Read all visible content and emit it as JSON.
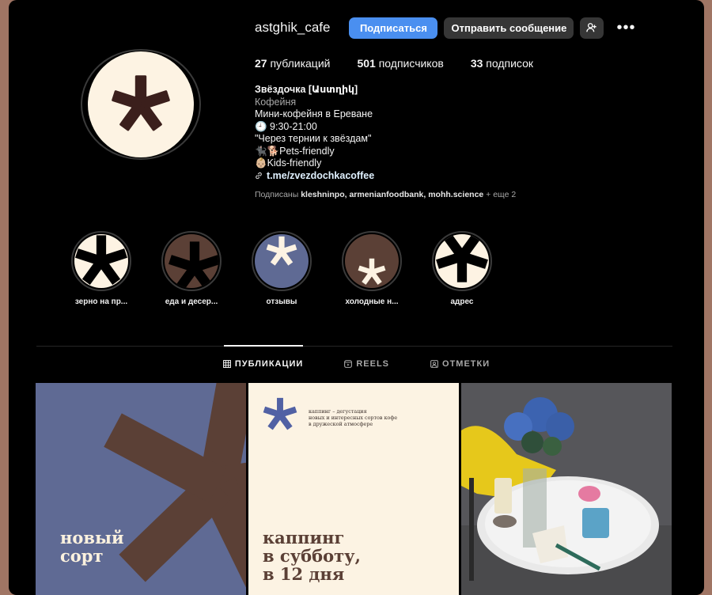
{
  "profile": {
    "username": "astghik_cafe",
    "follow_label": "Подписаться",
    "message_label": "Отправить сообщение",
    "stats": {
      "posts_count": "27",
      "posts_label": "публикаций",
      "followers_count": "501",
      "followers_label": "подписчиков",
      "following_count": "33",
      "following_label": "подписок"
    },
    "bio": {
      "name": "Звёздочка [Աստղիկ]",
      "category": "Кофейня",
      "line1": "Мини-кофейня в Ереване",
      "line2": "🕘 9:30-21:00",
      "line3": "\"Через тернии к звёздам\"",
      "line4": "🐈‍⬛🐕Pets-friendly",
      "line5": "👶🏼Kids-friendly",
      "link": "t.me/zvezdochkacoffee"
    },
    "followed_by": {
      "prefix": "Подписаны",
      "accounts": "kleshninpo, armenianfoodbank, mohh.science",
      "suffix": "+ еще 2"
    }
  },
  "highlights": [
    {
      "label": "зерно на пр..."
    },
    {
      "label": "еда и десер..."
    },
    {
      "label": "отзывы"
    },
    {
      "label": "холодные н..."
    },
    {
      "label": "адрес"
    }
  ],
  "tabs": {
    "posts": "ПУБЛИКАЦИИ",
    "reels": "REELS",
    "tagged": "ОТМЕТКИ"
  },
  "posts": {
    "p1_line1": "новый",
    "p1_line2": "сорт",
    "p2_small1": "каппинг – дегустация",
    "p2_small2": "новых и интересных сортов кофе",
    "p2_small3": "в дружеской атмосфере",
    "p2_line1": "каппинг",
    "p2_line2": "в субботу,",
    "p2_line3": "в 12 дня"
  },
  "colors": {
    "primary_button": "#4a8ff0",
    "brand_brown": "#5b4036",
    "brand_blue": "#5f6a94",
    "brand_cream": "#fcf3e3"
  }
}
